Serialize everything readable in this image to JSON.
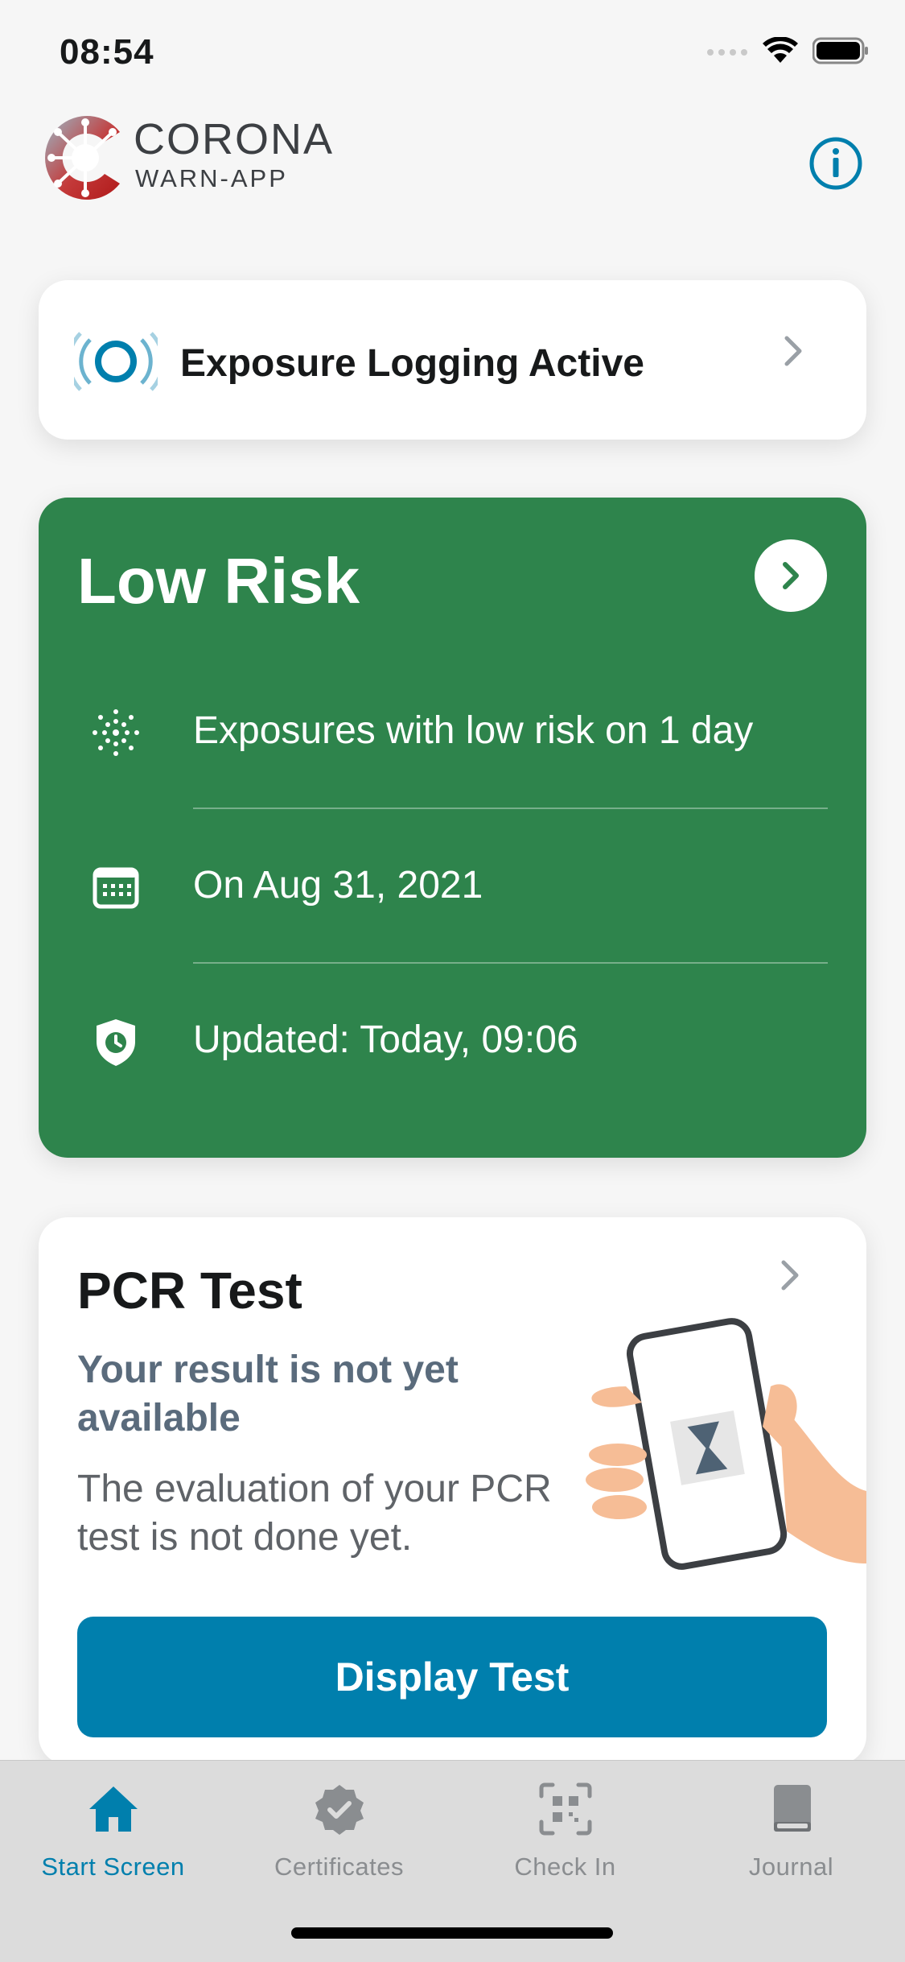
{
  "status_bar": {
    "time": "08:54"
  },
  "header": {
    "brand_title": "CORONA",
    "brand_subtitle": "WARN-APP"
  },
  "exposure_logging": {
    "label": "Exposure Logging Active"
  },
  "risk_card": {
    "title": "Low Risk",
    "color": "#2e844c",
    "rows": [
      {
        "icon": "virus-dots-icon",
        "text": "Exposures with low risk on 1 day"
      },
      {
        "icon": "calendar-icon",
        "text": "On Aug 31, 2021"
      },
      {
        "icon": "shield-clock-icon",
        "text": "Updated: Today, 09:06"
      }
    ]
  },
  "pcr_card": {
    "title": "PCR Test",
    "subtitle": "Your result is not yet available",
    "description": "The evaluation of your PCR test is not done yet.",
    "button_label": "Display Test",
    "button_color": "#007fad"
  },
  "tab_bar": {
    "active_color": "#007fad",
    "tabs": [
      {
        "label": "Start Screen",
        "icon": "home-icon",
        "active": true
      },
      {
        "label": "Certificates",
        "icon": "certificate-badge-icon",
        "active": false
      },
      {
        "label": "Check In",
        "icon": "qr-scan-icon",
        "active": false
      },
      {
        "label": "Journal",
        "icon": "book-icon",
        "active": false
      }
    ]
  }
}
